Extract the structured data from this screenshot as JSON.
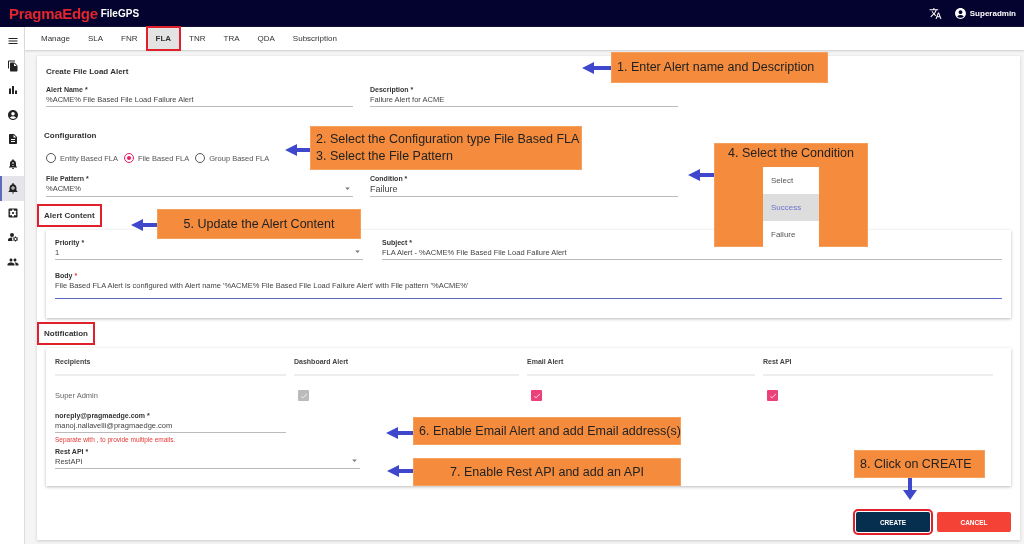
{
  "header": {
    "brand": "PragmaEdge",
    "product": "FileGPS",
    "user": "Superadmin"
  },
  "sidebar": {
    "items": [
      {
        "selected": false
      },
      {
        "selected": false
      },
      {
        "selected": false
      },
      {
        "selected": false
      },
      {
        "selected": false
      },
      {
        "selected": false
      },
      {
        "selected": true
      },
      {
        "selected": false
      },
      {
        "selected": false
      },
      {
        "selected": false
      }
    ]
  },
  "tabs": [
    {
      "label": "Manage",
      "selected": false,
      "highlighted": false
    },
    {
      "label": "SLA",
      "selected": false,
      "highlighted": false
    },
    {
      "label": "FNR",
      "selected": false,
      "highlighted": false
    },
    {
      "label": "FLA",
      "selected": true,
      "highlighted": true
    },
    {
      "label": "TNR",
      "selected": false,
      "highlighted": false
    },
    {
      "label": "TRA",
      "selected": false,
      "highlighted": false
    },
    {
      "label": "QDA",
      "selected": false,
      "highlighted": false
    },
    {
      "label": "Subscription",
      "selected": false,
      "highlighted": false
    }
  ],
  "form": {
    "title": "Create File Load Alert",
    "alert_name": {
      "label": "Alert Name *",
      "value": "%ACME% File Based File Load Failure Alert"
    },
    "description": {
      "label": "Description *",
      "value": "Failure Alert for ACME"
    },
    "configuration": {
      "heading": "Configuration",
      "options": [
        {
          "label": "Entity Based FLA",
          "selected": false
        },
        {
          "label": "File Based FLA",
          "selected": true
        },
        {
          "label": "Group Based FLA",
          "selected": false
        }
      ]
    },
    "file_pattern": {
      "label": "File Pattern *",
      "value": "%ACME%"
    },
    "condition": {
      "label": "Condition *",
      "value": "Failure"
    }
  },
  "alert_content": {
    "heading": "Alert Content",
    "highlighted": true,
    "priority": {
      "label": "Priority *",
      "value": "1"
    },
    "subject": {
      "label": "Subject *",
      "value": "FLA Alert - %ACME% File Based File Load Failure Alert"
    },
    "body": {
      "label": "Body",
      "required_mark": "*",
      "value": "File Based FLA Alert is configured with Alert name '%ACME% File Based File Load Failure Alert' with File pattern '%ACME%'",
      "focused": true
    }
  },
  "notification": {
    "heading": "Notification",
    "highlighted": true,
    "columns": [
      "Recipients",
      "Dashboard Alert",
      "Email Alert",
      "Rest API"
    ],
    "recipient": "Super Admin",
    "checkboxes": [
      {
        "checked": true,
        "disabled": true
      },
      {
        "checked": true,
        "disabled": false
      },
      {
        "checked": true,
        "disabled": false
      }
    ],
    "email": {
      "label": "noreply@pragmaedge.com *",
      "value": "manoj.nallavelli@pragmaedge.com",
      "helper": "Separate with , to provide multiple emails."
    },
    "rest_api": {
      "label": "Rest API *",
      "value": "RestAPI"
    }
  },
  "buttons": [
    {
      "label": "CREATE",
      "kind": "primary",
      "highlighted": true
    },
    {
      "label": "CANCEL",
      "kind": "danger",
      "highlighted": false
    }
  ],
  "annotations": [
    {
      "lines": [
        "1. Enter Alert name and Description"
      ],
      "kind": "side"
    },
    {
      "lines": [
        "2. Select the Configuration type File Based FLA",
        "3. Select the File Pattern"
      ],
      "kind": "side"
    },
    {
      "lines": [
        "4. Select the Condition"
      ],
      "kind": "side",
      "options": [
        {
          "label": "Select",
          "selected": false
        },
        {
          "label": "Success",
          "selected": true
        },
        {
          "label": "Failure",
          "selected": false
        }
      ]
    },
    {
      "lines": [
        "5. Update the Alert Content"
      ],
      "kind": "side"
    },
    {
      "lines": [
        "6. Enable Email Alert and add Email address(s)"
      ],
      "kind": "side"
    },
    {
      "lines": [
        "7. Enable Rest API and add an API"
      ],
      "kind": "side"
    },
    {
      "lines": [
        "8. Click on CREATE"
      ],
      "kind": "above"
    }
  ]
}
